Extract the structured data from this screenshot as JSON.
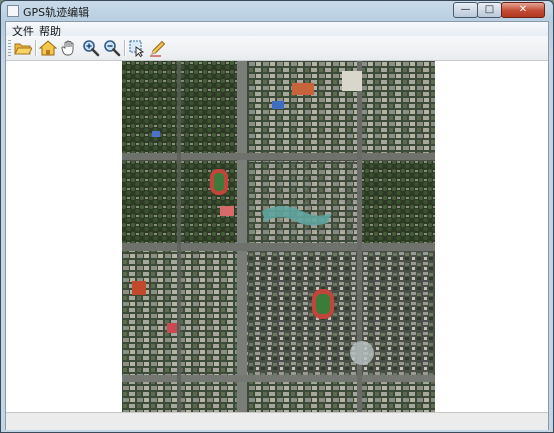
{
  "window": {
    "title": "GPS轨迹编辑",
    "minimize_label": "—",
    "maximize_label": "□",
    "close_label": "✕"
  },
  "menubar": {
    "items": [
      {
        "label": "文件"
      },
      {
        "label": "帮助"
      }
    ]
  },
  "toolbar": {
    "tools": [
      {
        "icon": "open-folder-icon"
      },
      {
        "icon": "home-icon"
      },
      {
        "icon": "pan-hand-icon"
      },
      {
        "icon": "zoom-in-icon"
      },
      {
        "icon": "zoom-out-icon"
      },
      {
        "icon": "select-region-icon"
      },
      {
        "icon": "edit-pencil-icon"
      }
    ]
  },
  "map": {
    "content": "satellite-imagery"
  },
  "colors": {
    "title_bar": "#b6cde0",
    "close_button": "#c24a32",
    "map_background": "#3a4236"
  }
}
